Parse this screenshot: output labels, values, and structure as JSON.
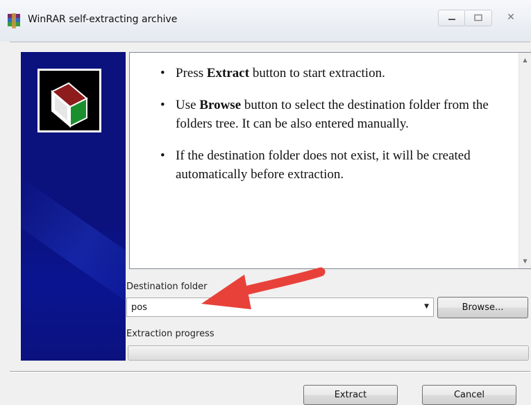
{
  "window": {
    "title": "WinRAR self-extracting archive",
    "icon": "winrar-icon",
    "controls": {
      "minimize": "minimize-icon",
      "maximize": "maximize-icon",
      "close": "close-icon",
      "close_glyph": "✕"
    }
  },
  "instructions": {
    "bullets": [
      {
        "before": "Press ",
        "bold": "Extract",
        "after": " button to start extraction."
      },
      {
        "before": "Use ",
        "bold": "Browse",
        "after": " button to select the destination folder from the folders tree. It can be also entered manually."
      },
      {
        "before": "",
        "bold": "",
        "after": "If the destination folder does not exist, it will be created automatically before extraction."
      }
    ]
  },
  "destination": {
    "label": "Destination folder",
    "value": "pos",
    "browse_label": "Browse..."
  },
  "progress": {
    "label": "Extraction progress",
    "value": 0
  },
  "buttons": {
    "extract_label": "Extract",
    "cancel_label": "Cancel"
  },
  "colors": {
    "side_panel": "#0b127e",
    "annotation_arrow": "#e8413a"
  }
}
